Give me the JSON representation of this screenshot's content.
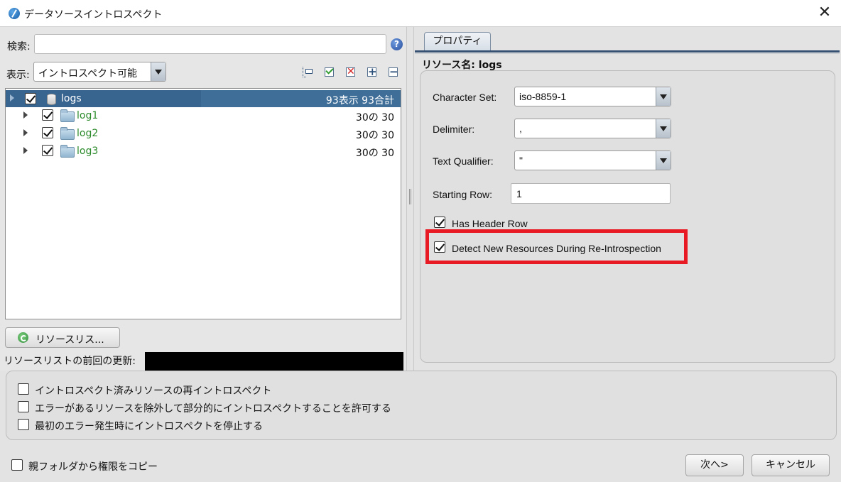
{
  "window": {
    "title": "データソースイントロスペクト",
    "close_symbol": "✕"
  },
  "left": {
    "search_label": "検索:",
    "search_value": "",
    "help_symbol": "?",
    "view_label": "表示:",
    "view_value": "イントロスペクト可能",
    "toolbar_icons": [
      "tree-expand-icon",
      "check-all-icon",
      "uncheck-all-icon",
      "expand-all-icon",
      "collapse-all-icon"
    ],
    "tree": [
      {
        "label": "logs",
        "count": "93表示 93合計",
        "checked": true,
        "selected": true,
        "type": "database"
      },
      {
        "label": "log1",
        "count": "30の 30",
        "checked": true,
        "type": "folder"
      },
      {
        "label": "log2",
        "count": "30の 30",
        "checked": true,
        "type": "folder"
      },
      {
        "label": "log3",
        "count": "30の 30",
        "checked": true,
        "type": "folder"
      }
    ],
    "refresh_label": "リソースリス...",
    "last_update_label": "リソースリストの前回の更新:",
    "last_update_value": ""
  },
  "right": {
    "tab_label": "プロパティ",
    "resource_title": "リソース名: logs",
    "character_set_label": "Character Set:",
    "character_set_value": "iso-8859-1",
    "delimiter_label": "Delimiter:",
    "delimiter_value": ",",
    "text_qualifier_label": "Text Qualifier:",
    "text_qualifier_value": "\"",
    "starting_row_label": "Starting Row:",
    "starting_row_value": "1",
    "has_header_label": "Has Header Row",
    "has_header_checked": true,
    "detect_new_label": "Detect New Resources During Re-Introspection",
    "detect_new_checked": true,
    "highlight_color": "#e81a24"
  },
  "options": {
    "reintrospect_label": "イントロスペクト済みリソースの再イントロスペクト",
    "partial_label": "エラーがあるリソースを除外して部分的にイントロスペクトすることを許可する",
    "stop_on_error_label": "最初のエラー発生時にイントロスペクトを停止する"
  },
  "footer": {
    "copy_perm_label": "親フォルダから権限をコピー",
    "next_label": "次へ>",
    "cancel_label": "キャンセル"
  }
}
